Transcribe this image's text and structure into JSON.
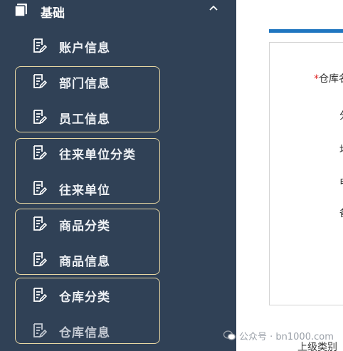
{
  "sidebar": {
    "group": {
      "label": "基础",
      "icon": "database-icon",
      "chevron": "chevron-up-icon"
    },
    "items": [
      {
        "label": "账户信息",
        "icon": "edit-note-icon"
      },
      {
        "label": "部门信息",
        "icon": "edit-note-icon"
      },
      {
        "label": "员工信息",
        "icon": "edit-note-icon"
      },
      {
        "label": "往来单位分类",
        "icon": "edit-note-icon"
      },
      {
        "label": "往来单位",
        "icon": "edit-note-icon"
      },
      {
        "label": "商品分类",
        "icon": "edit-note-icon"
      },
      {
        "label": "商品信息",
        "icon": "edit-note-icon"
      },
      {
        "label": "仓库分类",
        "icon": "edit-note-icon"
      },
      {
        "label": "仓库信息",
        "icon": "edit-note-icon"
      }
    ],
    "colors": {
      "background": "#304156",
      "frame": "#e8d7a3"
    }
  },
  "main": {
    "form": {
      "required_mark": "*",
      "field_name": "仓库名",
      "partial_labels": [
        "分",
        "地",
        "电",
        "备"
      ]
    },
    "bottom_label": "上级类别"
  },
  "watermark": {
    "text": "公众号 · bn1000.com",
    "icon": "wechat-icon"
  }
}
